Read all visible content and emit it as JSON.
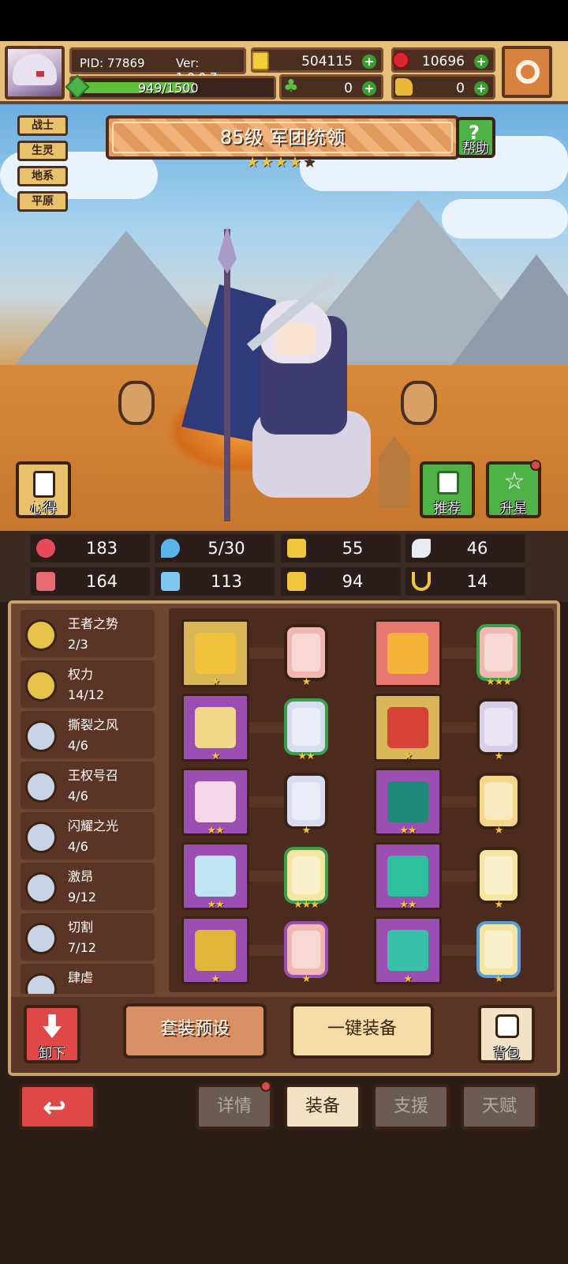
{
  "header": {
    "pid": "PID: 77869",
    "version": "Ver: 1.0.0.7",
    "xp_text": "949/1500",
    "xp_fraction": 0.633,
    "currencies": [
      {
        "name": "coin-icon",
        "value": "504115"
      },
      {
        "name": "ruby-icon",
        "value": "10696"
      },
      {
        "name": "clover-icon",
        "value": "0"
      },
      {
        "name": "bag-icon",
        "value": "0"
      }
    ]
  },
  "hero": {
    "tags": [
      "战士",
      "生灵",
      "地系",
      "平原"
    ],
    "rank_title": "85级 军团统领",
    "stars_filled": 4,
    "stars_total": 5,
    "help_label": "帮助",
    "insight_label": "心得",
    "recommend_label": "推荐",
    "upgrade_label": "升星"
  },
  "stats": [
    {
      "icon": "heart-icon",
      "value": "183"
    },
    {
      "icon": "water-drop-icon",
      "value": "5/30"
    },
    {
      "icon": "shield-icon",
      "value": "55"
    },
    {
      "icon": "wing-icon",
      "value": "46"
    },
    {
      "icon": "fist-icon",
      "value": "164"
    },
    {
      "icon": "book-icon",
      "value": "113"
    },
    {
      "icon": "scroll-icon",
      "value": "94"
    },
    {
      "icon": "horseshoe-icon",
      "value": "14"
    }
  ],
  "sets": [
    {
      "name": "王者之势",
      "count": "2/3",
      "color": "#e6c24a"
    },
    {
      "name": "权力",
      "count": "14/12",
      "color": "#e6c24a"
    },
    {
      "name": "撕裂之风",
      "count": "4/6",
      "color": "#c9d3e6"
    },
    {
      "name": "王权号召",
      "count": "4/6",
      "color": "#c9d3e6"
    },
    {
      "name": "闪耀之光",
      "count": "4/6",
      "color": "#c9d3e6"
    },
    {
      "name": "激昂",
      "count": "9/12",
      "color": "#c9d3e6"
    },
    {
      "name": "切割",
      "count": "7/12",
      "color": "#c9d3e6"
    },
    {
      "name": "肆虐",
      "count": "",
      "color": "#c9d3e6"
    }
  ],
  "equipment": [
    {
      "item": "mace",
      "item_stars": "★",
      "rune_stars": "★"
    },
    {
      "item": "hat",
      "item_stars": "",
      "rune_stars": "★★★"
    },
    {
      "item": "amulet",
      "item_stars": "★",
      "rune_stars": "★★"
    },
    {
      "item": "armor",
      "item_stars": "★",
      "rune_stars": "★"
    },
    {
      "item": "necklace",
      "item_stars": "★★",
      "rune_stars": "★"
    },
    {
      "item": "bracer",
      "item_stars": "★★",
      "rune_stars": "★"
    },
    {
      "item": "gem",
      "item_stars": "★★",
      "rune_stars": "★★★"
    },
    {
      "item": "belt",
      "item_stars": "★★",
      "rune_stars": "★"
    },
    {
      "item": "ring",
      "item_stars": "★",
      "rune_stars": "★"
    },
    {
      "item": "boots",
      "item_stars": "★",
      "rune_stars": "★"
    }
  ],
  "actions": {
    "unload_label": "卸下",
    "preset_label": "套装预设",
    "equip_all_label": "一键装备",
    "bag_label": "背包"
  },
  "nav": {
    "tabs": [
      "详情",
      "装备",
      "支援",
      "天赋"
    ],
    "active": "装备"
  }
}
